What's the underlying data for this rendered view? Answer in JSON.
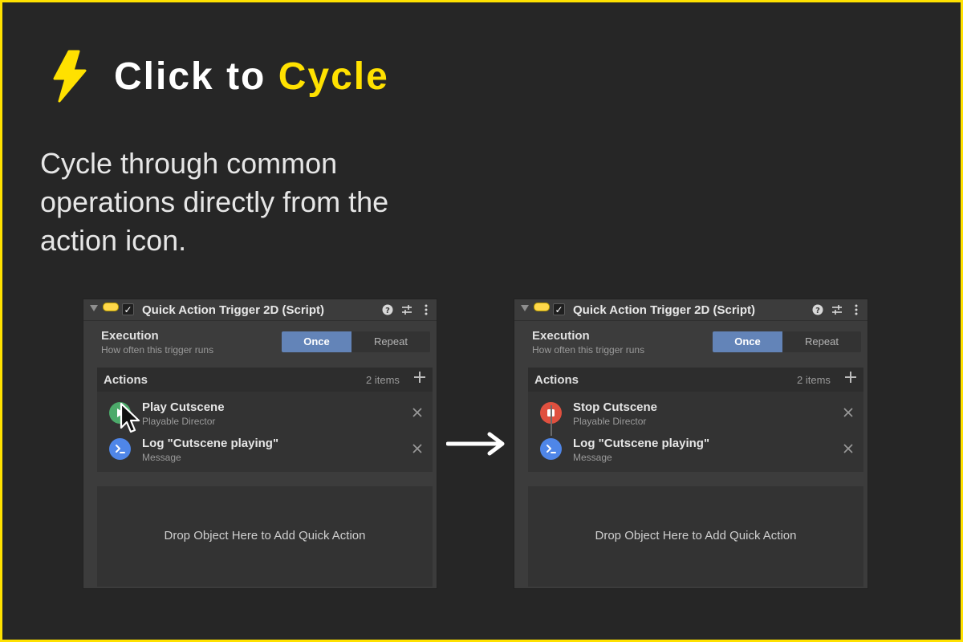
{
  "hero": {
    "title_main": "Click to ",
    "title_accent": "Cycle",
    "subtitle": "Cycle through common operations directly from the action icon.",
    "accent_color": "#ffe100",
    "icon": "lightning-bolt-icon"
  },
  "panels": [
    {
      "header_title": "Quick Action Trigger 2D (Script)",
      "execution": {
        "title": "Execution",
        "description": "How often this trigger runs",
        "options": [
          "Once",
          "Repeat"
        ],
        "selected": "Once"
      },
      "actions": {
        "title": "Actions",
        "count": "2 items",
        "items": [
          {
            "title": "Play Cutscene",
            "subtitle": "Playable Director",
            "icon": "play-icon",
            "color": "#4caa6a"
          },
          {
            "title": "Log \"Cutscene playing\"",
            "subtitle": "Message",
            "icon": "terminal-icon",
            "color": "#4f86e8"
          }
        ]
      },
      "drop_text": "Drop Object Here to Add Quick Action"
    },
    {
      "header_title": "Quick Action Trigger 2D (Script)",
      "execution": {
        "title": "Execution",
        "description": "How often this trigger runs",
        "options": [
          "Once",
          "Repeat"
        ],
        "selected": "Once"
      },
      "actions": {
        "title": "Actions",
        "count": "2 items",
        "items": [
          {
            "title": "Stop Cutscene",
            "subtitle": "Playable Director",
            "icon": "stop-icon",
            "color": "#e0503f"
          },
          {
            "title": "Log \"Cutscene playing\"",
            "subtitle": "Message",
            "icon": "terminal-icon",
            "color": "#4f86e8"
          }
        ]
      },
      "drop_text": "Drop Object Here to Add Quick Action"
    }
  ]
}
